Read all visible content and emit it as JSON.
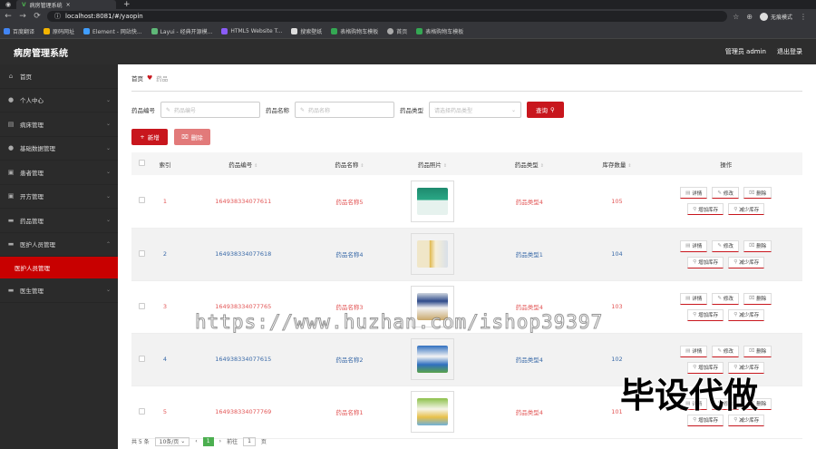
{
  "browser": {
    "tab_title": "病房管理系统",
    "url": "localhost:8081/#/yaopin",
    "profile_label": "无痕模式",
    "bookmarks": [
      "百度翻译",
      "原码网址",
      "Element - 网站快...",
      "Layui - 经典开源模...",
      "HTML5 Website T...",
      "搜索壁纸",
      "表格购物车模板",
      "首页",
      "表格购物车模板"
    ]
  },
  "header": {
    "title": "病房管理系统",
    "user": "管理员 admin",
    "logout": "退出登录"
  },
  "sidebar": {
    "items": [
      {
        "label": "首页"
      },
      {
        "label": "个人中心"
      },
      {
        "label": "病床管理"
      },
      {
        "label": "基础数据管理"
      },
      {
        "label": "患者管理"
      },
      {
        "label": "开方管理"
      },
      {
        "label": "药品管理"
      },
      {
        "label": "医护人员管理"
      },
      {
        "label": "医护人员管理"
      },
      {
        "label": "医生管理"
      }
    ]
  },
  "breadcrumb": {
    "home": "首页",
    "current": "药品"
  },
  "search": {
    "code_label": "药品编号",
    "code_placeholder": "药品编号",
    "name_label": "药品名称",
    "name_placeholder": "药品名称",
    "type_label": "药品类型",
    "type_placeholder": "请选择药品类型",
    "button": "查询"
  },
  "actions": {
    "add": "新增",
    "delete": "删除"
  },
  "table": {
    "columns": [
      "索引",
      "药品编号",
      "药品名称",
      "药品照片",
      "药品类型",
      "库存数量",
      "操作"
    ],
    "rows": [
      {
        "index": "1",
        "code": "164938334077611",
        "name": "药品名称5",
        "type": "药品类型4",
        "stock": "105"
      },
      {
        "index": "2",
        "code": "164938334077618",
        "name": "药品名称4",
        "type": "药品类型1",
        "stock": "104"
      },
      {
        "index": "3",
        "code": "164938334077765",
        "name": "药品名称3",
        "type": "药品类型4",
        "stock": "103"
      },
      {
        "index": "4",
        "code": "164938334077615",
        "name": "药品名称2",
        "type": "药品类型4",
        "stock": "102"
      },
      {
        "index": "5",
        "code": "164938334077769",
        "name": "药品名称1",
        "type": "药品类型4",
        "stock": "101"
      }
    ],
    "ops": {
      "detail": "详情",
      "edit": "修改",
      "delete": "删除",
      "add_stock": "增加库存",
      "reduce_stock": "减少库存"
    }
  },
  "pagination": {
    "total": "共 5 条",
    "page_size": "10条/页",
    "current": "1",
    "jump_label": "前往",
    "jump_value": "1",
    "page_unit": "页"
  },
  "watermark": {
    "url": "https://www.huzhan.com/ishop39397",
    "text": "毕设代做"
  },
  "colors": {
    "accent": "#c8161d",
    "sidebar_bg": "#2b2b2b",
    "header_bg": "#2d2d2d"
  }
}
